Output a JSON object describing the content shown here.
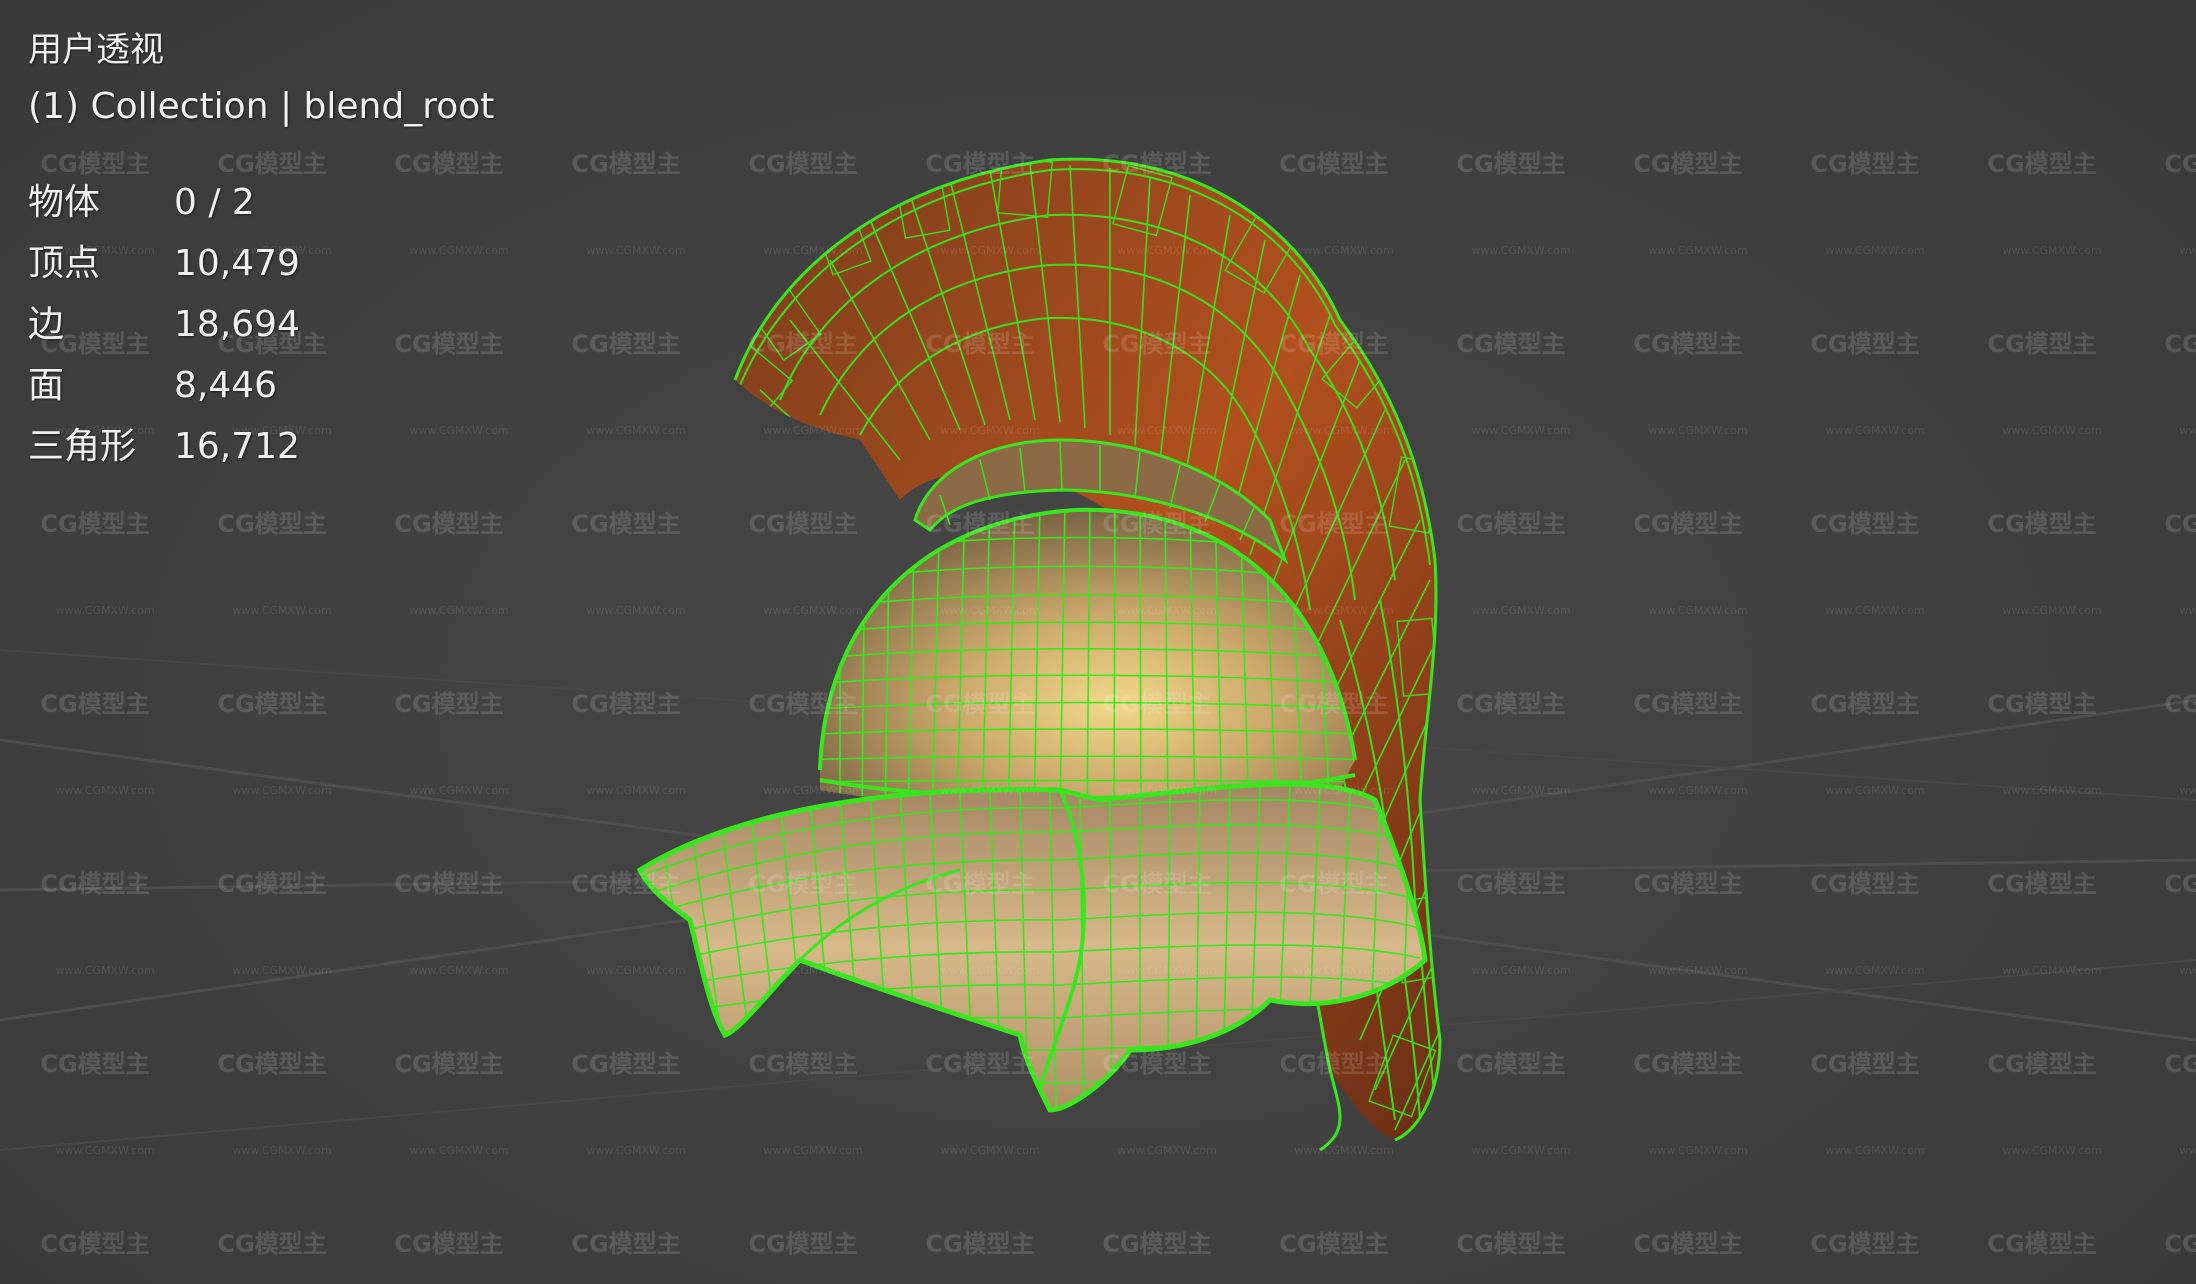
{
  "viewport": {
    "view_name": "用户透视",
    "collection_line": "(1) Collection | blend_root",
    "background_color": "#404040",
    "wireframe_color": "#39e61e",
    "helmet_color": "#c9a56a",
    "plume_color": "#b2501e"
  },
  "stats": [
    {
      "label": "物体",
      "value": "0 / 2"
    },
    {
      "label": "顶点",
      "value": "10,479"
    },
    {
      "label": "边",
      "value": "18,694"
    },
    {
      "label": "面",
      "value": "8,446"
    },
    {
      "label": "三角形",
      "value": "16,712"
    }
  ],
  "watermark": {
    "logo_text": "CG模型主",
    "url_text": "www.CGMXW.com"
  }
}
